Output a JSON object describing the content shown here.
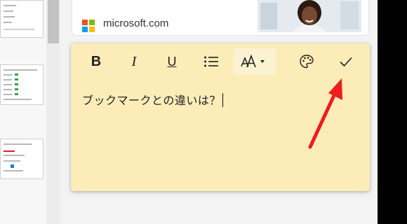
{
  "card": {
    "site": "microsoft.com",
    "logo_colors": [
      "#f25022",
      "#7fba00",
      "#00a4ef",
      "#ffb900"
    ]
  },
  "note": {
    "text": "ブックマークとの違いは？",
    "background": "#fcecb8"
  },
  "toolbar": {
    "bold_label": "B",
    "italic_label": "I",
    "underline_label": "U",
    "list_icon": "bullet-list-icon",
    "font_size_icon": "font-size-icon",
    "palette_icon": "palette-icon",
    "confirm_icon": "checkmark-icon"
  },
  "annotation": {
    "arrow_color": "#ee1c1c"
  }
}
